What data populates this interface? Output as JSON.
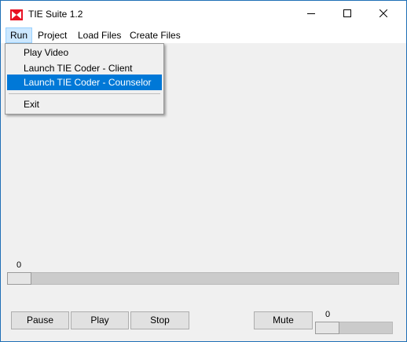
{
  "window": {
    "title": "TIE Suite 1.2",
    "icon": "bowtie-app-icon"
  },
  "titlebar": {
    "minimize_icon": "minimize-icon",
    "maximize_icon": "maximize-icon",
    "close_icon": "close-icon"
  },
  "menubar": {
    "items": [
      {
        "label": "Run",
        "open": true
      },
      {
        "label": "Project"
      },
      {
        "label": "Load Files"
      },
      {
        "label": "Create Files"
      }
    ]
  },
  "run_menu": {
    "items": [
      {
        "label": "Play Video"
      },
      {
        "label": "Launch TIE Coder - Client"
      },
      {
        "label": "Launch TIE Coder - Counselor",
        "highlighted": true
      },
      {
        "label": "Exit"
      }
    ]
  },
  "video_position": {
    "label": "0",
    "value": 0
  },
  "controls": {
    "pause_label": "Pause",
    "play_label": "Play",
    "stop_label": "Stop",
    "mute_label": "Mute"
  },
  "volume": {
    "label": "0",
    "value": 0
  },
  "colors": {
    "menu_highlight": "#0078d7",
    "menu_open_bg": "#cce8ff",
    "icon_red": "#e81123"
  }
}
